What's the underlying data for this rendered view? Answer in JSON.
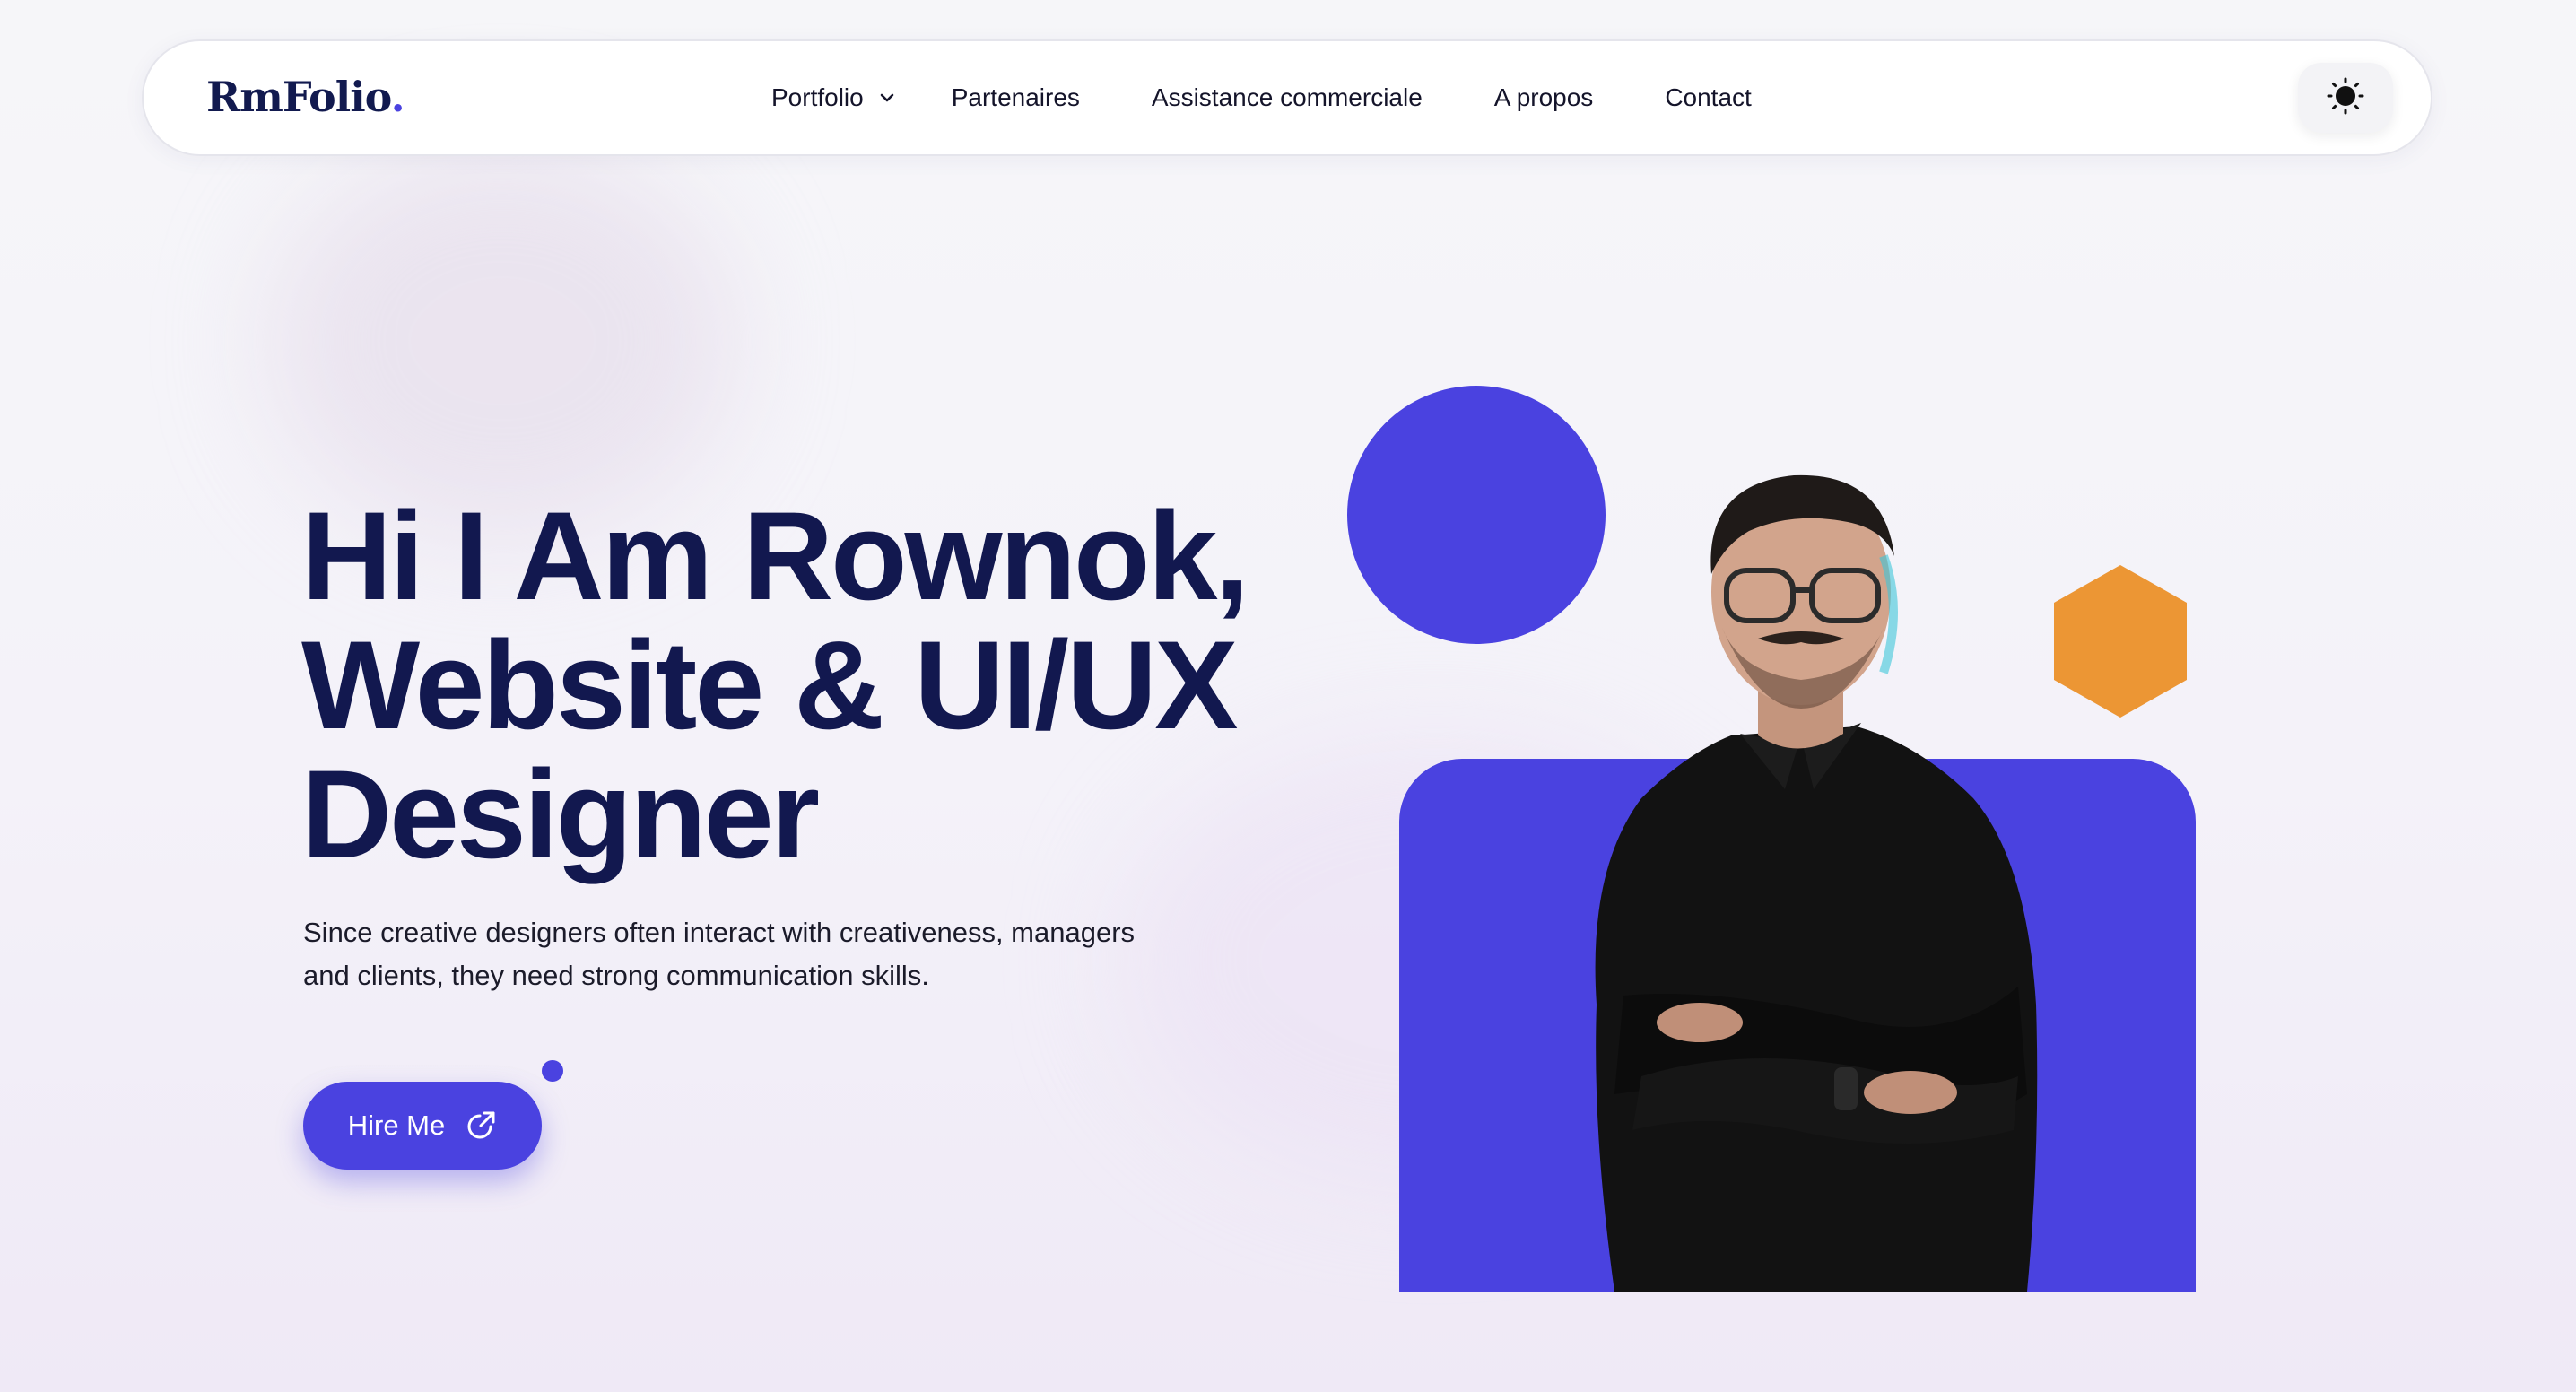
{
  "brand": {
    "logo_text": "RmFolio",
    "logo_dot": "."
  },
  "nav": {
    "items": [
      {
        "label": "Portfolio",
        "has_dropdown": true
      },
      {
        "label": "Partenaires"
      },
      {
        "label": "Assistance commerciale"
      },
      {
        "label": "A propos"
      },
      {
        "label": "Contact"
      }
    ],
    "theme_toggle_icon": "sun-icon"
  },
  "hero": {
    "title_lines": [
      "Hi I Am Rownok,",
      "Website & UI/UX",
      "Designer"
    ],
    "description_lines": [
      "Since creative designers often interact with creativeness, managers",
      "and clients, they need strong communication skills."
    ],
    "cta_label": "Hire Me",
    "cta_icon": "external-link-icon"
  },
  "colors": {
    "primary": "#4a42e0",
    "heading": "#12184f",
    "accent_orange": "#ec9634",
    "background": "#f5f4f9"
  },
  "decorations": {
    "circle_icon": "blue-circle",
    "hexagon_icon": "orange-hexagon"
  }
}
